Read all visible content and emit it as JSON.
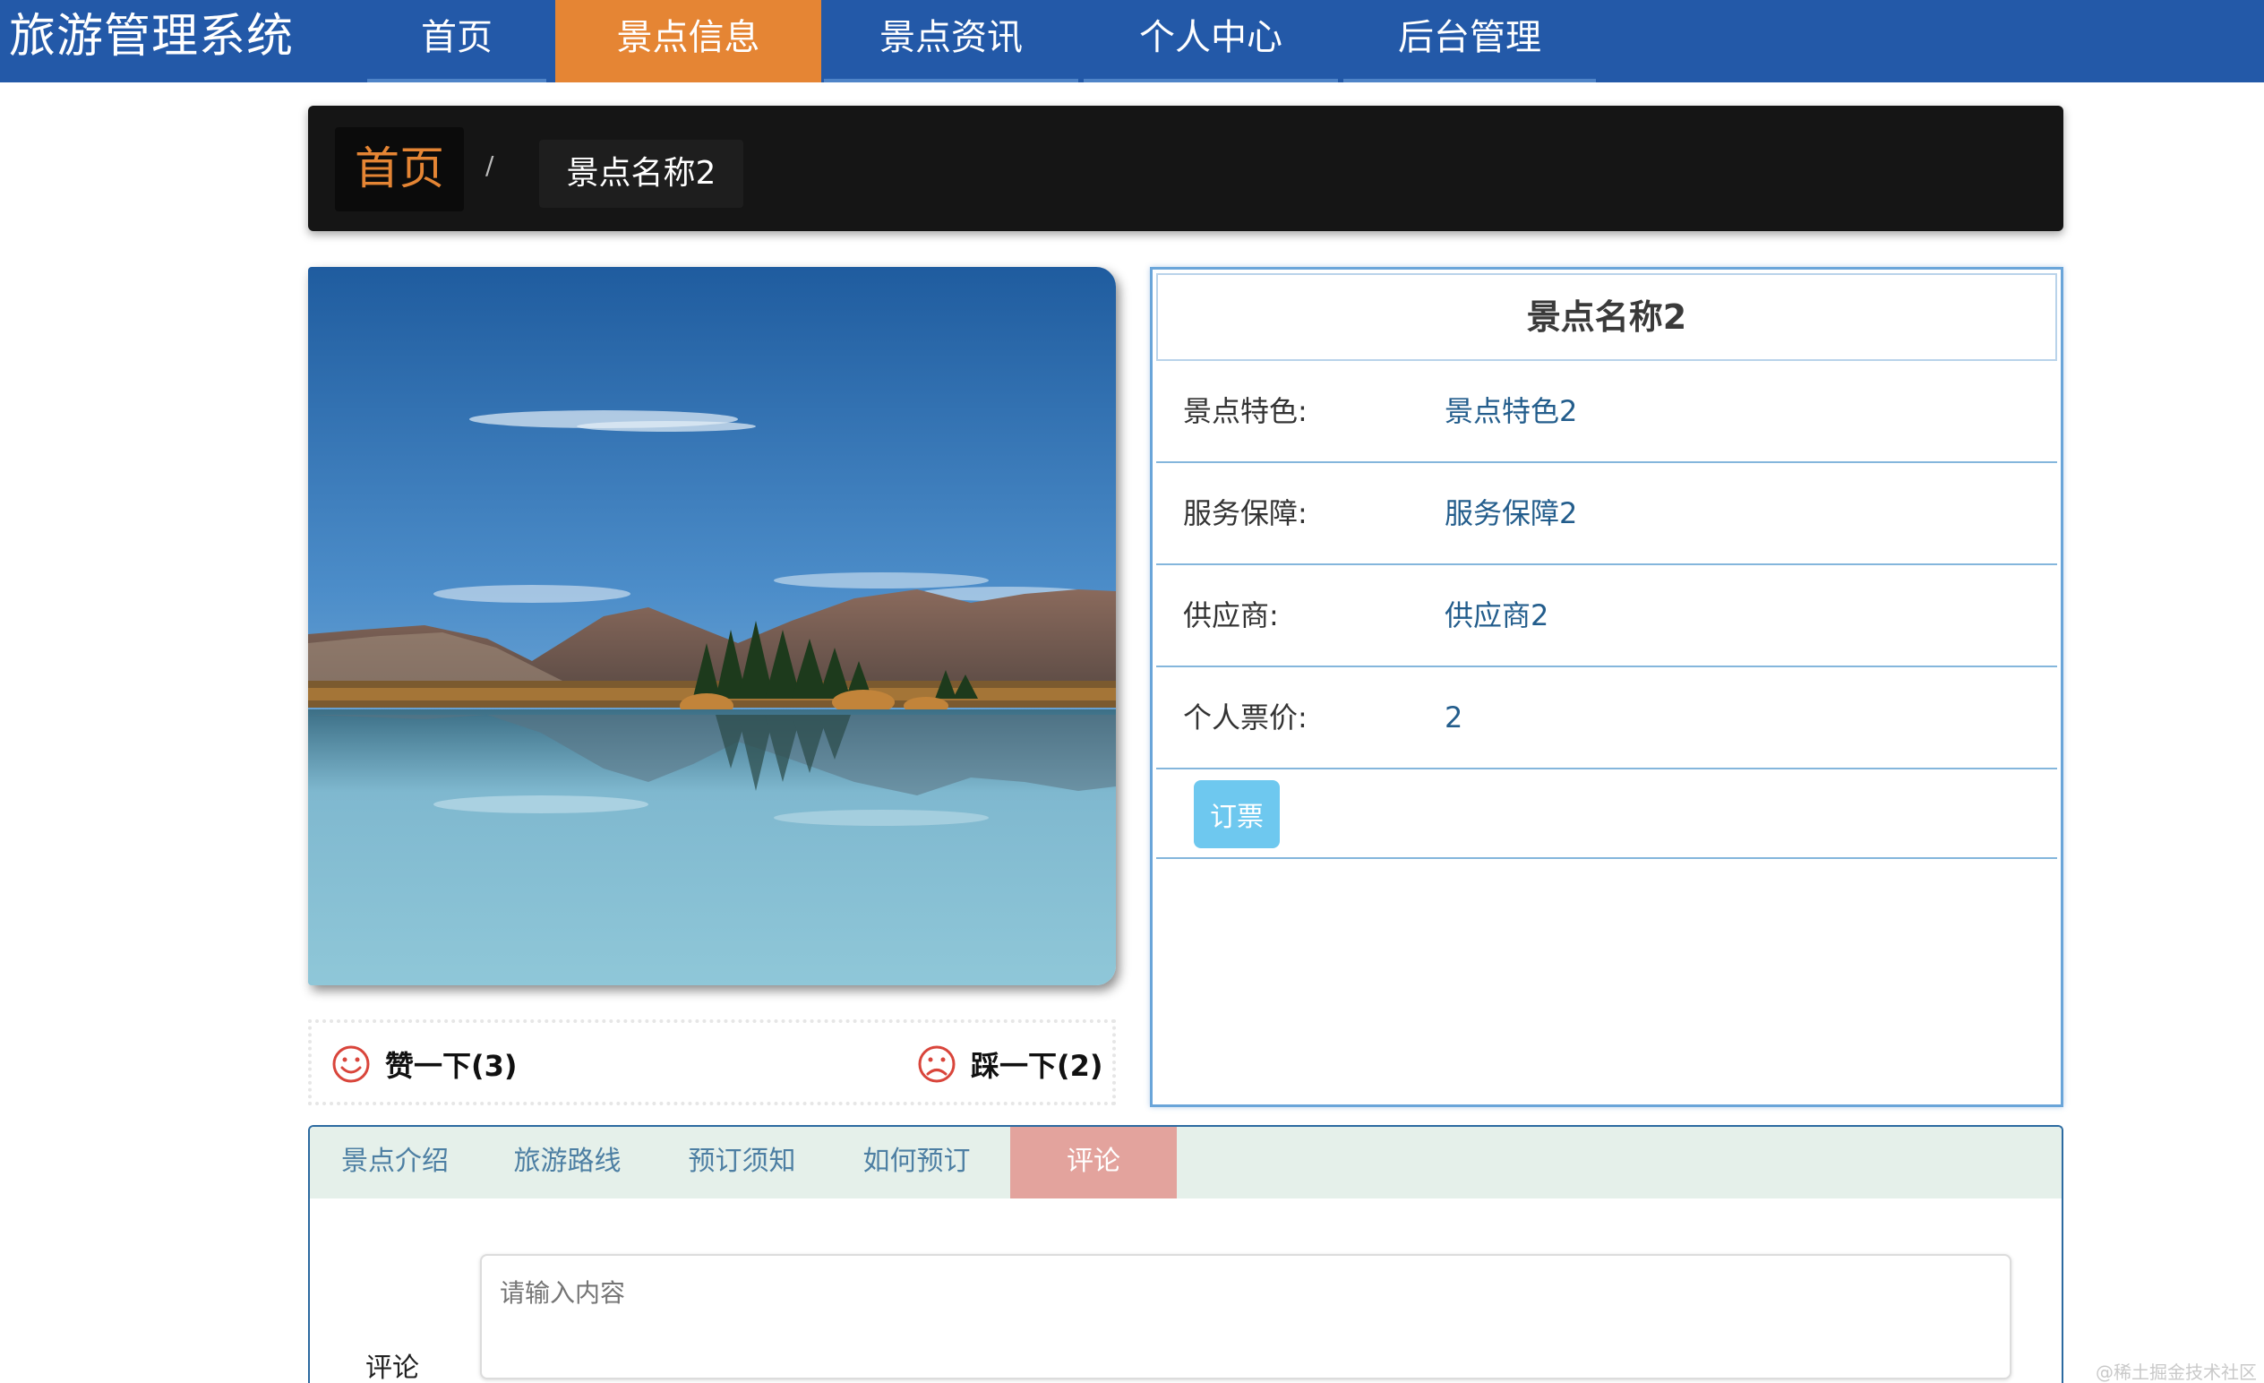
{
  "header": {
    "brand": "旅游管理系统",
    "nav": [
      {
        "label": "首页",
        "active": false
      },
      {
        "label": "景点信息",
        "active": true
      },
      {
        "label": "景点资讯",
        "active": false
      },
      {
        "label": "个人中心",
        "active": false
      },
      {
        "label": "后台管理",
        "active": false
      }
    ]
  },
  "breadcrumb": {
    "home": "首页",
    "separator": "/",
    "current": "景点名称2"
  },
  "votes": {
    "like": "赞一下(3)",
    "dislike": "踩一下(2)"
  },
  "detail": {
    "title": "景点名称2",
    "rows": [
      {
        "key": "景点特色:",
        "value": "景点特色2"
      },
      {
        "key": "服务保障:",
        "value": "服务保障2"
      },
      {
        "key": "供应商:",
        "value": "供应商2"
      },
      {
        "key": "个人票价:",
        "value": "2"
      }
    ],
    "book_label": "订票"
  },
  "tabs": [
    {
      "label": "景点介绍",
      "active": false
    },
    {
      "label": "旅游路线",
      "active": false
    },
    {
      "label": "预订须知",
      "active": false
    },
    {
      "label": "如何预订",
      "active": false
    },
    {
      "label": "评论",
      "active": true
    }
  ],
  "comment": {
    "label": "评论",
    "placeholder": "请输入内容"
  },
  "watermark": "@稀土掘金技术社区",
  "colors": {
    "nav_bg": "#2359a8",
    "nav_active": "#e58534",
    "crumb_bg": "#151515",
    "panel_border": "#6aa5d9",
    "book_button": "#6ec8ef",
    "tab_strip": "#e5f0ea",
    "tab_active": "#e3a39d",
    "vote_icon": "#d9453b"
  },
  "icons": {
    "like": "smiley-face-icon",
    "dislike": "sad-face-icon"
  }
}
